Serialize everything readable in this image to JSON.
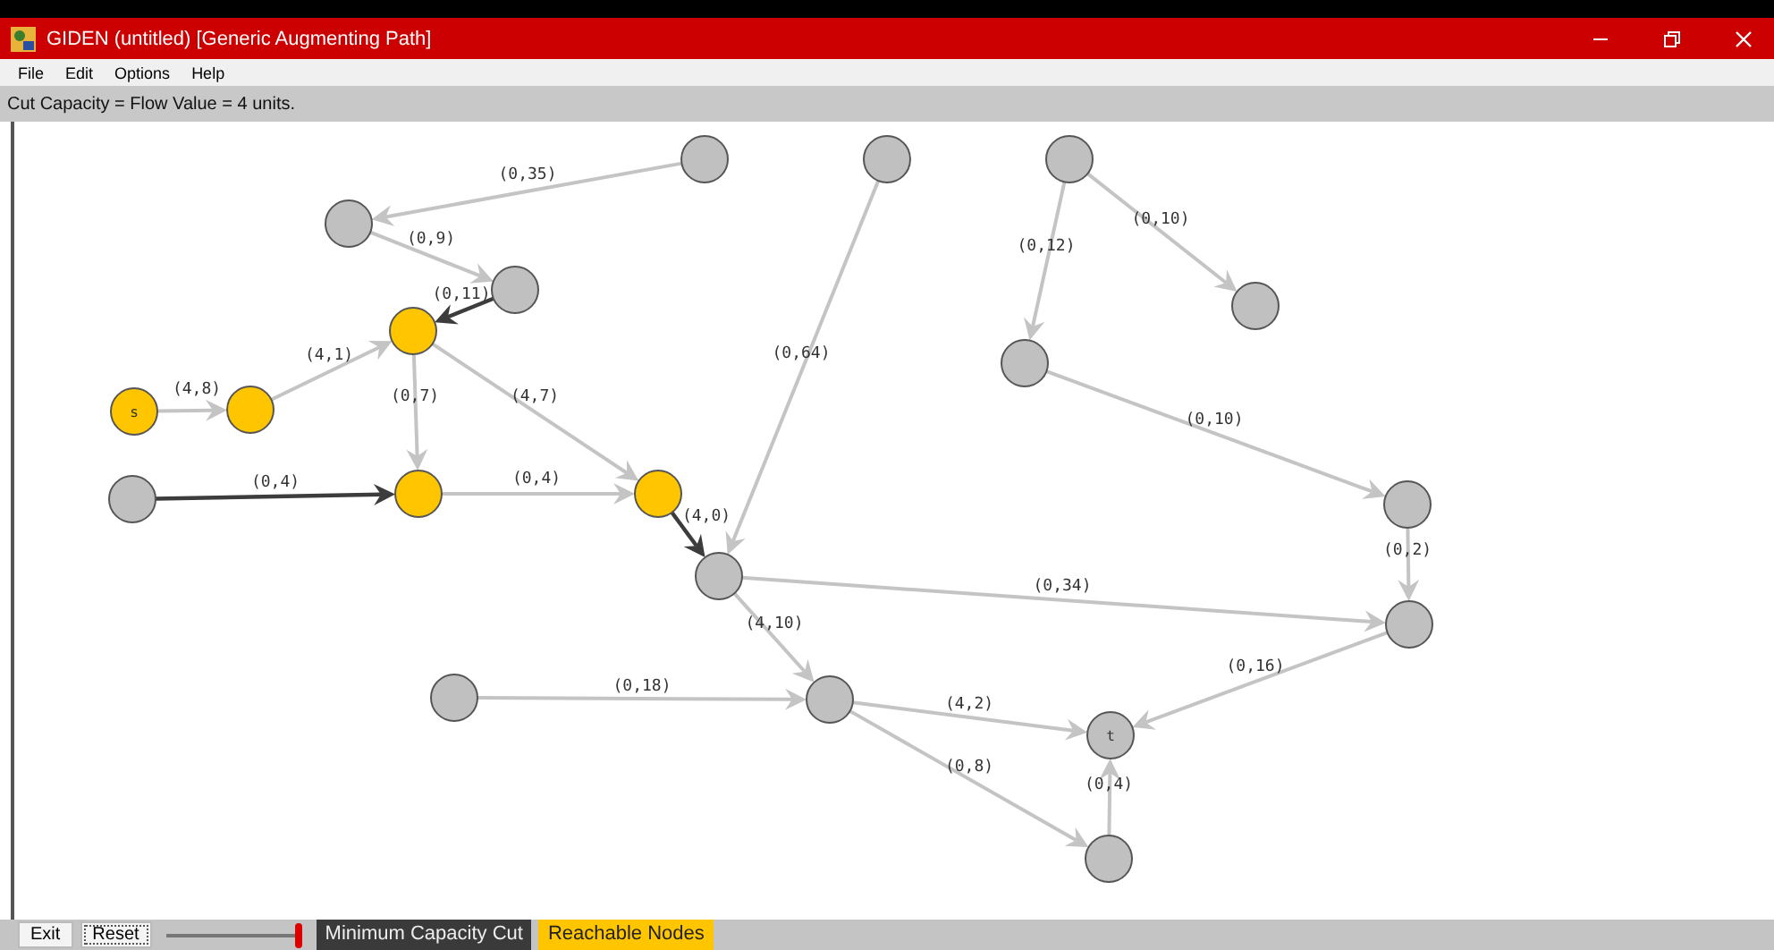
{
  "window": {
    "title": "GIDEN  (untitled)  [Generic Augmenting Path]"
  },
  "menu": [
    "File",
    "Edit",
    "Options",
    "Help"
  ],
  "info_bar": "Cut Capacity = Flow Value = 4 units.",
  "graph": {
    "nodes": [
      {
        "label": "s",
        "reachable": true
      },
      {
        "reachable": true
      },
      {
        "reachable": true
      },
      {
        "reachable": true
      },
      {
        "reachable": true
      },
      {
        "reachable": false
      },
      {
        "reachable": false
      },
      {
        "reachable": false
      },
      {
        "reachable": false
      },
      {
        "reachable": false
      },
      {
        "reachable": false
      },
      {
        "reachable": false
      },
      {
        "reachable": false
      },
      {
        "reachable": false
      },
      {
        "reachable": false
      },
      {
        "reachable": false
      },
      {
        "reachable": false
      },
      {
        "reachable": false
      },
      {
        "label": "t",
        "reachable": false
      },
      {
        "reachable": false
      }
    ],
    "edges": [
      {
        "label": "(4,8)",
        "in_cut": false
      },
      {
        "label": "(4,1)",
        "in_cut": false
      },
      {
        "label": "(0,7)",
        "in_cut": false
      },
      {
        "label": "(4,7)",
        "in_cut": false
      },
      {
        "label": "(0,4)",
        "in_cut": false
      },
      {
        "label": "(0,4)",
        "in_cut": true
      },
      {
        "label": "(0,11)",
        "in_cut": true
      },
      {
        "label": "(0,35)",
        "in_cut": false
      },
      {
        "label": "(0,9)",
        "in_cut": false
      },
      {
        "label": "(0,64)",
        "in_cut": false
      },
      {
        "label": "(4,0)",
        "in_cut": true
      },
      {
        "label": "(0,12)",
        "in_cut": false
      },
      {
        "label": "(0,10)",
        "in_cut": false
      },
      {
        "label": "(0,10)",
        "in_cut": false
      },
      {
        "label": "(0,2)",
        "in_cut": false
      },
      {
        "label": "(0,34)",
        "in_cut": false
      },
      {
        "label": "(4,10)",
        "in_cut": false
      },
      {
        "label": "(0,18)",
        "in_cut": false
      },
      {
        "label": "(4,2)",
        "in_cut": false
      },
      {
        "label": "(0,8)",
        "in_cut": false
      },
      {
        "label": "(0,4)",
        "in_cut": false
      },
      {
        "label": "(0,16)",
        "in_cut": false
      }
    ]
  },
  "bottom_bar": {
    "buttons": [
      "Exit",
      "Reset"
    ],
    "slider": {
      "level": 1
    },
    "legend": [
      {
        "label": "Minimum Capacity Cut",
        "kind": "cut"
      },
      {
        "label": "Reachable Nodes",
        "kind": "reachable"
      }
    ]
  }
}
